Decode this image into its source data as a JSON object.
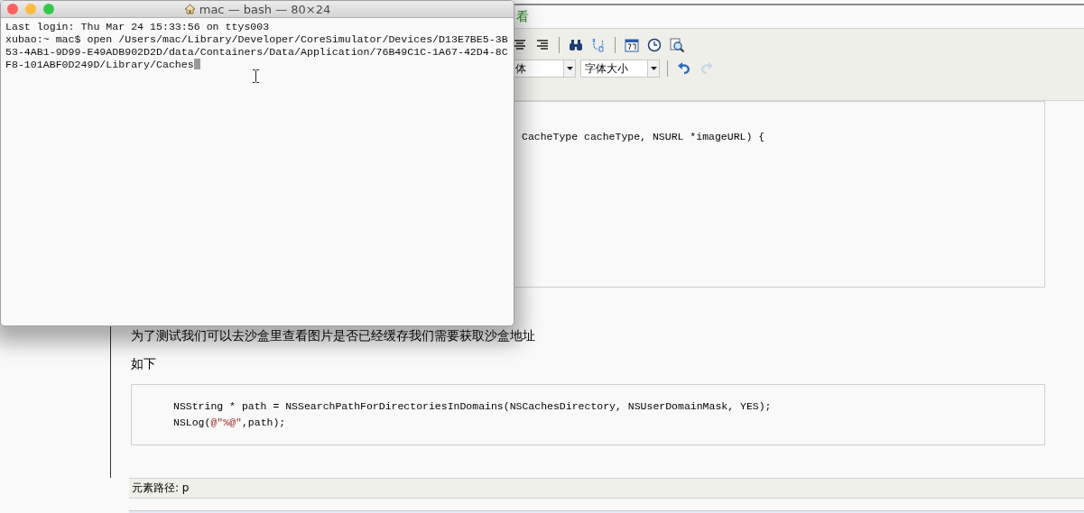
{
  "terminal": {
    "title": "mac — bash — 80×24",
    "lines": [
      "Last login: Thu Mar 24 15:33:56 on ttys003",
      "xubao:~ mac$ open /Users/mac/Library/Developer/CoreSimulator/Devices/D13E7BE5-3B",
      "53-4AB1-9D99-E49ADB902D2D/data/Containers/Data/Application/76B49C1C-1A67-42D4-8C",
      "F8-101ABF0D249D/Library/Caches"
    ]
  },
  "editor": {
    "tab_label": "看",
    "toolbar": {
      "row_1": [
        {
          "kind": "align-center",
          "disabled": false
        },
        {
          "kind": "align-right",
          "disabled": false
        },
        {
          "kind": "separator"
        },
        {
          "kind": "find",
          "disabled": false
        },
        {
          "kind": "replace",
          "disabled": false
        },
        {
          "kind": "separator"
        },
        {
          "kind": "date",
          "disabled": false
        },
        {
          "kind": "time",
          "disabled": false
        },
        {
          "kind": "preview",
          "disabled": false
        }
      ],
      "row_2": [
        {
          "kind": "select",
          "value": "体"
        },
        {
          "kind": "select",
          "value": "字体大小"
        },
        {
          "kind": "separator"
        },
        {
          "kind": "undo",
          "disabled": false
        },
        {
          "kind": "redo",
          "disabled": true
        }
      ]
    },
    "content": [
      {
        "kind": "code",
        "lines": [
          [
            {
              "text": "CacheType cacheType, NSURL *imageURL) {"
            }
          ]
        ]
      },
      {
        "kind": "paragraph",
        "text": "为了测试我们可以去沙盒里查看图片是否已经缓存我们需要获取沙盒地址"
      },
      {
        "kind": "paragraph",
        "text": "如下"
      },
      {
        "kind": "code",
        "lines": [
          [
            {
              "text": "NSString * path = NSSearchPathForDirectoriesInDomains(NSCachesDirectory, NSUserDomainMask, YES);"
            }
          ],
          [
            {
              "text": "NSLog("
            },
            {
              "text": "@\"%@\"",
              "kind": "string"
            },
            {
              "text": ",path);"
            }
          ]
        ]
      }
    ],
    "status_bar": "元素路径: p"
  }
}
